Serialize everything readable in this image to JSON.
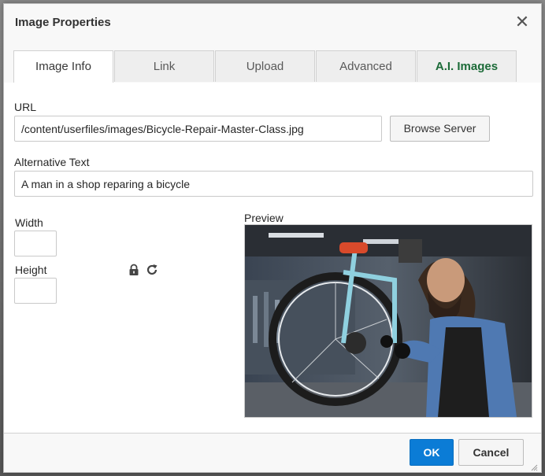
{
  "dialog": {
    "title": "Image Properties",
    "tabs": [
      {
        "label": "Image Info",
        "active": true
      },
      {
        "label": "Link",
        "active": false
      },
      {
        "label": "Upload",
        "active": false
      },
      {
        "label": "Advanced",
        "active": false
      },
      {
        "label": "A.I. Images",
        "active": false
      }
    ],
    "ai_tab_color": "#1c6b38"
  },
  "form": {
    "url_label": "URL",
    "url_value": "/content/userfiles/images/Bicycle-Repair-Master-Class.jpg",
    "browse_label": "Browse Server",
    "alt_label": "Alternative Text",
    "alt_value": "A man in a shop reparing a bicycle",
    "width_label": "Width",
    "width_value": "",
    "height_label": "Height",
    "height_value": "",
    "lock_icon": "lock-icon",
    "reset_icon": "reset-size-icon",
    "preview_label": "Preview"
  },
  "footer": {
    "ok_label": "OK",
    "cancel_label": "Cancel",
    "ok_color": "#0b7cd6"
  }
}
